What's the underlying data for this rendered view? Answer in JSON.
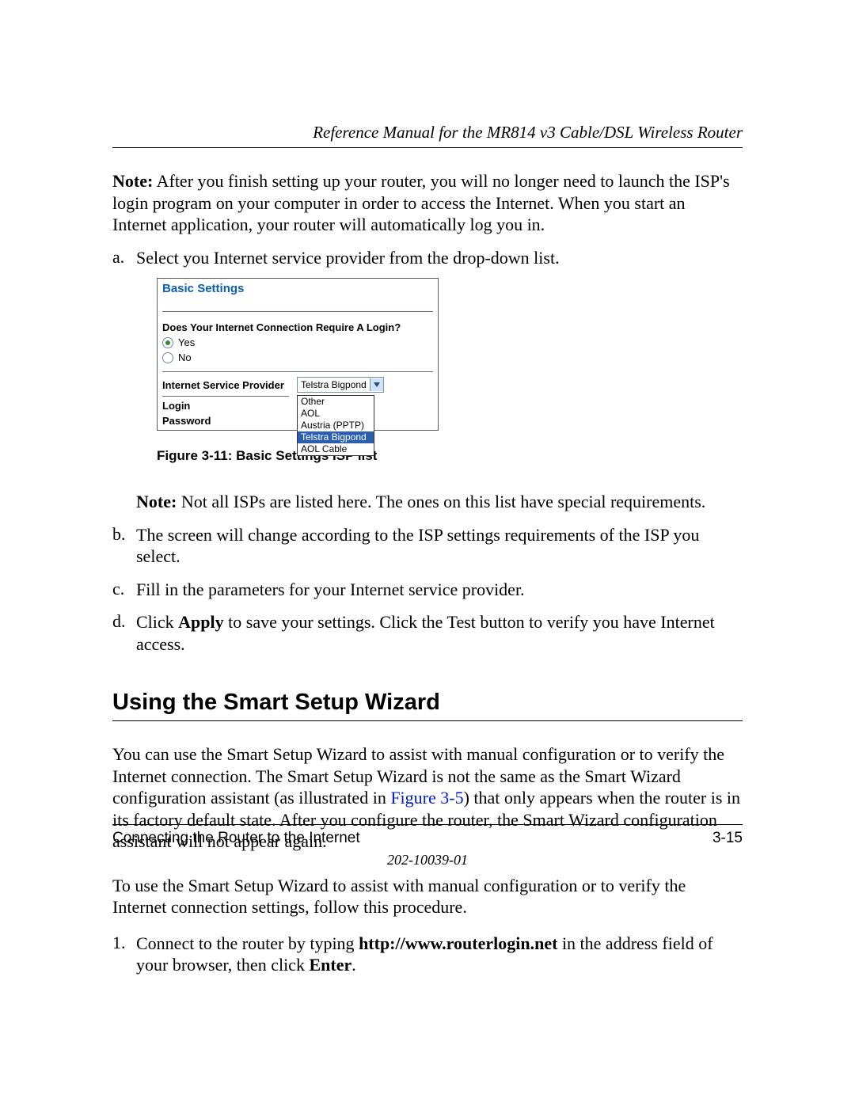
{
  "header": {
    "title": "Reference Manual for the MR814 v3 Cable/DSL Wireless Router"
  },
  "note1": {
    "label": "Note:",
    "text": " After you finish setting up your router, you will no longer need to launch the ISP's login program on your computer in order to access the Internet. When you start an Internet application, your router will automatically log you in."
  },
  "list_a": {
    "marker": "a.",
    "text": "Select you Internet service provider from the drop-down list."
  },
  "screenshot": {
    "title": "Basic Settings",
    "question": "Does Your Internet Connection Require A Login?",
    "yes": "Yes",
    "no": "No",
    "isp_label": "Internet Service Provider",
    "isp_selected": "Telstra Bigpond",
    "dropdown": {
      "opt0": "Other",
      "opt1": "AOL",
      "opt2": "Austria (PPTP)",
      "opt3": "Telstra Bigpond",
      "opt4": "AOL Cable"
    },
    "login_label": "Login",
    "password_label": "Password"
  },
  "figure_caption": "Figure 3-11:  Basic Settings ISP list",
  "note2": {
    "label": "Note:",
    "text": " Not all ISPs are listed here. The ones on this list have special requirements."
  },
  "list_b": {
    "marker": "b.",
    "text": "The screen will change according to the ISP settings requirements of the ISP you select."
  },
  "list_c": {
    "marker": "c.",
    "text": "Fill in the parameters for your Internet service provider."
  },
  "list_d": {
    "marker": "d.",
    "pre": "Click ",
    "apply": "Apply",
    "post": " to save your settings. Click the Test button to verify you have Internet access."
  },
  "h2": "Using the Smart Setup Wizard",
  "para2": {
    "pre": "You can use the Smart Setup Wizard to assist with manual configuration or to verify the Internet connection. The Smart Setup Wizard is not the same as the Smart Wizard configuration assistant (as illustrated in ",
    "link": "Figure 3-5",
    "post": ") that only appears when the router is in its factory default state. After you configure the router, the Smart Wizard configuration assistant will not appear again."
  },
  "para3": "To use the Smart Setup Wizard to assist with manual configuration or to verify the Internet connection settings, follow this procedure.",
  "step1": {
    "marker": "1.",
    "pre": "Connect to the router by typing ",
    "url": "http://www.routerlogin.net",
    "mid": " in the address field of your browser, then click ",
    "enter": "Enter",
    "post": "."
  },
  "footer": {
    "left": "Connecting the Router to the Internet",
    "right": "3-15",
    "docnum": "202-10039-01"
  }
}
